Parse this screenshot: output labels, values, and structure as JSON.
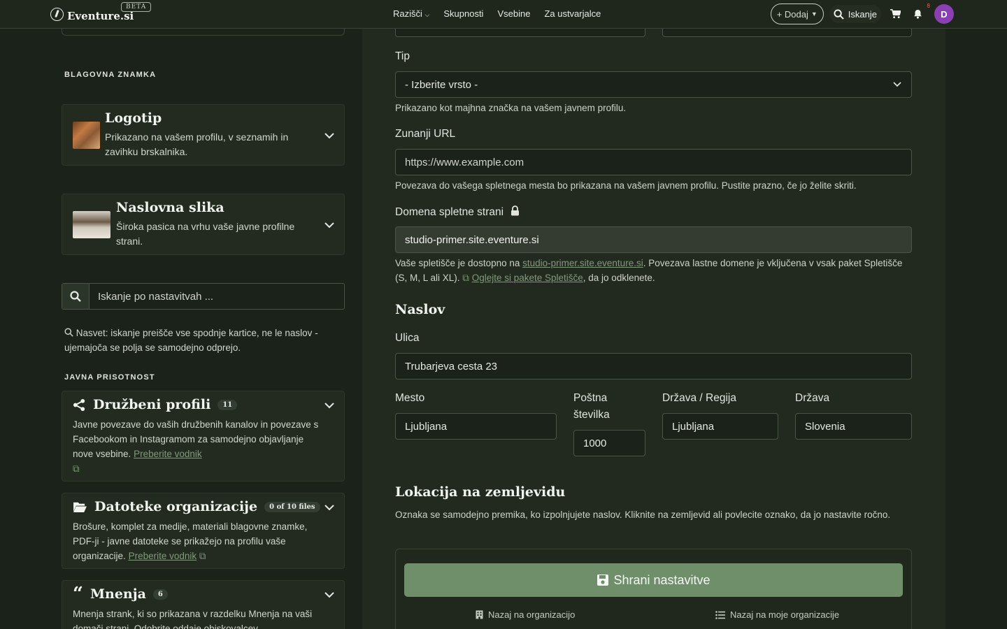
{
  "navbar": {
    "brand": "Eventure.si",
    "beta": "BETA",
    "links": [
      "Razišči",
      "Skupnosti",
      "Vsebine",
      "Za ustvarjalce"
    ],
    "add_label": "+ Dodaj",
    "search_label": "Iskanje",
    "notifications_count": "8",
    "avatar_initial": "D"
  },
  "sidebar": {
    "brand_section_title": "BLAGOVNA ZNAMKA",
    "logo_card": {
      "title": "Logotip",
      "description": "Prikazano na vašem profilu, v seznamih in zavihku brskalnika."
    },
    "cover_card": {
      "title": "Naslovna slika",
      "description": "Široka pasica na vrhu vaše javne profilne strani."
    },
    "search_placeholder": "Iskanje po nastavitvah ...",
    "hint": "Nasvet: iskanje preišče vse spodnje kartice, ne le naslov - ujemajoča se polja se samodejno odprejo.",
    "public_section_title": "JAVNA PRISOTNOST",
    "social_card": {
      "title": "Družbeni profili",
      "badge": "11",
      "description": "Javne povezave do vaših družbenih kanalov in povezave s Facebookom in Instagramom za samodejno objavljanje nove vsebine.",
      "link": "Preberite vodnik"
    },
    "files_card": {
      "title": "Datoteke organizacije",
      "badge": "0 of 10 files",
      "description": "Brošure, komplet za medije, materiali blagovne znamke, PDF-ji - javne datoteke se prikažejo na profilu vaše organizacije.",
      "link": "Preberite vodnik"
    },
    "reviews_card": {
      "title": "Mnenja",
      "badge": "6",
      "description": "Mnenja strank, ki so prikazana v razdelku Mnenja na vaši domači strani. Odobrite oddaje obiskovalcev"
    }
  },
  "main": {
    "type_label": "Tip",
    "type_value": "- Izberite vrsto -",
    "type_help": "Prikazano kot majhna značka na vašem javnem profilu.",
    "url_label": "Zunanji URL",
    "url_placeholder": "https://www.example.com",
    "url_help": "Povezava do vašega spletnega mesta bo prikazana na vašem javnem profilu. Pustite prazno, če jo želite skriti.",
    "domain_label": "Domena spletne strani",
    "domain_value": "studio-primer.site.eventure.si",
    "domain_help_1": "Vaše spletišče je dostopno na ",
    "domain_help_link": "studio-primer.site.eventure.si",
    "domain_help_2": ". Povezava lastne domene je vključena v vsak paket Spletišče (S, M, L ali XL). ",
    "domain_help_link2": "Oglejte si pakete Spletišče",
    "domain_help_3": ", da jo odklenete.",
    "address_title": "Naslov",
    "street_label": "Ulica",
    "street_value": "Trubarjeva cesta 23",
    "city_label": "Mesto",
    "city_value": "Ljubljana",
    "postal_label": "Poštna številka",
    "postal_value": "1000",
    "region_label": "Država / Regija",
    "region_value": "Ljubljana",
    "country_label": "Država",
    "country_value": "Slovenia",
    "map_title": "Lokacija na zemljevidu",
    "map_help": "Oznaka se samodejno premika, ko izpolnjujete naslov. Kliknite na zemljevid ali povlecite oznako, da jo nastavite ročno.",
    "save_label": "Shrani nastavitve",
    "back_org": "Nazaj na organizacijo",
    "back_my_orgs": "Nazaj na moje organizacije"
  },
  "colors": {
    "background": "#1b2219",
    "panel": "#222a1f",
    "accent": "#6f8f6b",
    "link": "#7f9b79",
    "avatar": "#8c3fb4"
  }
}
